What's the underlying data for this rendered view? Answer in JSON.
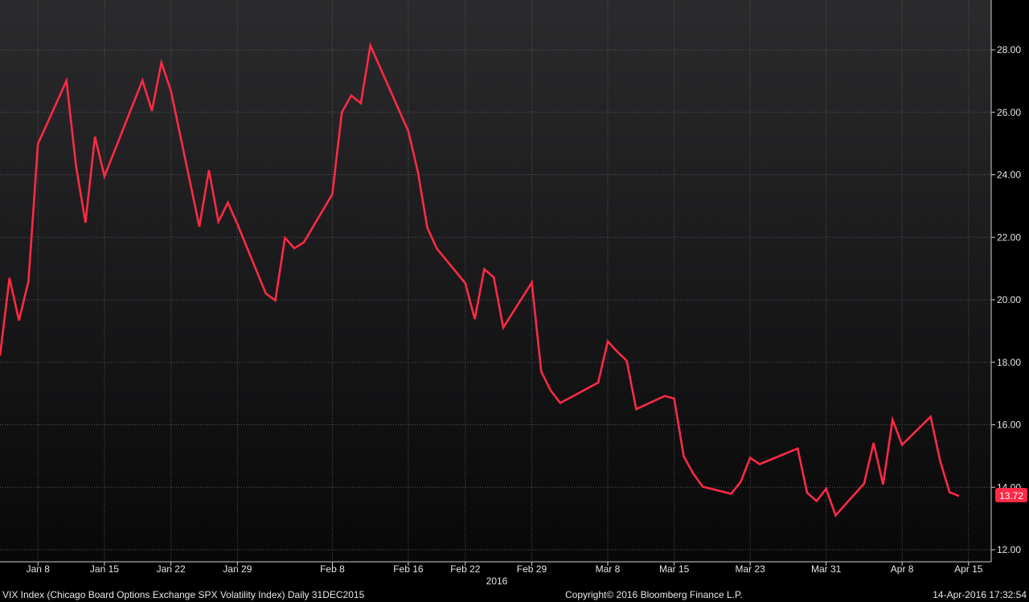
{
  "chart_data": {
    "type": "line",
    "title": "",
    "xlabel": "2016",
    "ylabel": "",
    "ylim": [
      11.8,
      29.4
    ],
    "grid": true,
    "x_ticks": [
      "Jan 8",
      "Jan 15",
      "Jan 22",
      "Jan 29",
      "Feb 8",
      "Feb 16",
      "Feb 22",
      "Feb 29",
      "Mar 8",
      "Mar 15",
      "Mar 23",
      "Mar 31",
      "Apr 8",
      "Apr 15"
    ],
    "y_ticks": [
      "12.00",
      "14.00",
      "16.00",
      "18.00",
      "20.00",
      "22.00",
      "24.00",
      "26.00",
      "28.00"
    ],
    "year_label": "2016",
    "last_value_label": "13.72",
    "colors": {
      "line": "#ff2a45",
      "badge": "#ff2a45",
      "grid": "#5a5a5a",
      "text": "#e6e6e6"
    },
    "series": [
      {
        "x": [
          "2016-01-04",
          "2016-01-05",
          "2016-01-06",
          "2016-01-07",
          "2016-01-08",
          "2016-01-11",
          "2016-01-12",
          "2016-01-13",
          "2016-01-14",
          "2016-01-15",
          "2016-01-19",
          "2016-01-20",
          "2016-01-21",
          "2016-01-22",
          "2016-01-25",
          "2016-01-26",
          "2016-01-27",
          "2016-01-28",
          "2016-01-29",
          "2016-02-01",
          "2016-02-02",
          "2016-02-03",
          "2016-02-04",
          "2016-02-05",
          "2016-02-08",
          "2016-02-09",
          "2016-02-10",
          "2016-02-11",
          "2016-02-12",
          "2016-02-16",
          "2016-02-17",
          "2016-02-18",
          "2016-02-19",
          "2016-02-22",
          "2016-02-23",
          "2016-02-24",
          "2016-02-25",
          "2016-02-26",
          "2016-02-29",
          "2016-03-01",
          "2016-03-02",
          "2016-03-03",
          "2016-03-04",
          "2016-03-07",
          "2016-03-08",
          "2016-03-09",
          "2016-03-10",
          "2016-03-11",
          "2016-03-14",
          "2016-03-15",
          "2016-03-16",
          "2016-03-17",
          "2016-03-18",
          "2016-03-21",
          "2016-03-22",
          "2016-03-23",
          "2016-03-24",
          "2016-03-28",
          "2016-03-29",
          "2016-03-30",
          "2016-03-31",
          "2016-04-01",
          "2016-04-04",
          "2016-04-05",
          "2016-04-06",
          "2016-04-07",
          "2016-04-08",
          "2016-04-11",
          "2016-04-12",
          "2016-04-13",
          "2016-04-14"
        ],
        "values": [
          18.21,
          20.7,
          19.34,
          20.59,
          24.99,
          27.01,
          24.3,
          22.47,
          25.22,
          23.95,
          27.02,
          26.05,
          27.59,
          26.69,
          22.34,
          24.15,
          22.5,
          23.11,
          22.42,
          20.2,
          19.98,
          21.98,
          21.65,
          21.84,
          23.38,
          26.0,
          26.54,
          26.29,
          28.14,
          25.4,
          24.11,
          22.31,
          21.64,
          20.53,
          19.38,
          20.98,
          20.72,
          19.11,
          20.55,
          17.7,
          17.09,
          16.7,
          16.86,
          17.35,
          18.67,
          18.34,
          18.05,
          16.5,
          16.92,
          16.84,
          14.99,
          14.44,
          14.02,
          13.79,
          14.17,
          14.94,
          14.74,
          15.24,
          13.82,
          13.56,
          13.95,
          13.1,
          14.12,
          15.42,
          14.09,
          16.16,
          15.36,
          16.26,
          14.85,
          13.84,
          13.72
        ]
      }
    ]
  },
  "footer": {
    "left": "VIX Index (Chicago Board Options Exchange SPX Volatility Index)  Daily 31DEC2015",
    "center": "Copyright© 2016 Bloomberg Finance L.P.",
    "right": "14-Apr-2016 17:32:54"
  }
}
